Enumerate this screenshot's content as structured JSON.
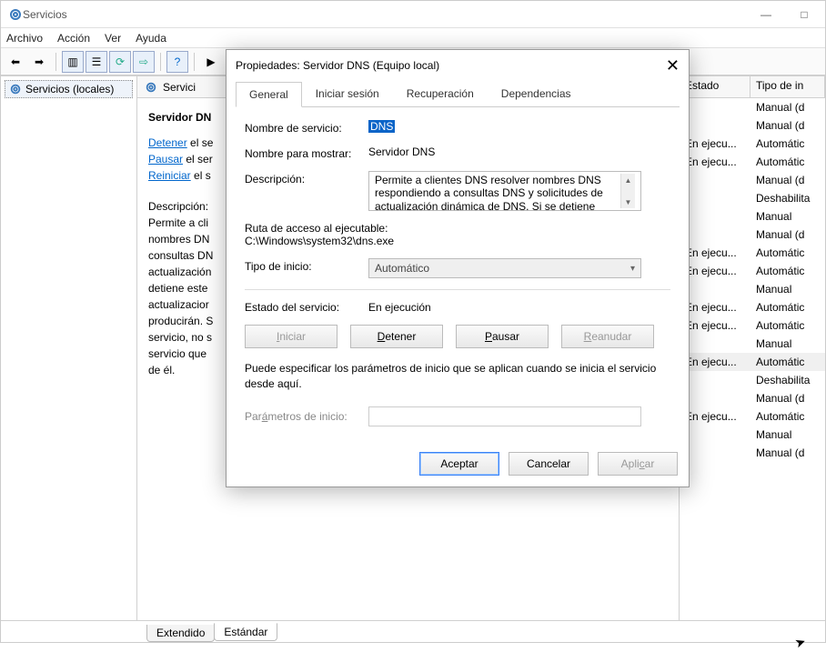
{
  "window": {
    "title": "Servicios",
    "minimize": "—",
    "maximize": "□",
    "close": "✕"
  },
  "menu": {
    "archivo": "Archivo",
    "accion": "Acción",
    "ver": "Ver",
    "ayuda": "Ayuda"
  },
  "nav": {
    "servicios_locales": "Servicios (locales)"
  },
  "center": {
    "header": "Servici",
    "svc_name": "Servidor DN",
    "link_detener_pre": "Detener",
    "link_detener_suf": " el se",
    "link_pausar_pre": "Pausar",
    "link_pausar_suf": " el ser",
    "link_reiniciar_pre": "Reiniciar",
    "link_reiniciar_suf": " el s",
    "desc_label": "Descripción:",
    "desc": "Permite a cli\nnombres DN\nconsultas DN\nactualización\ndetiene este\nactualizacior\nproducirán. S\nservicio, no s\nservicio que\nde él."
  },
  "list": {
    "col_estado": "Estado",
    "col_tipo": "Tipo de in",
    "rows": [
      {
        "estado": "",
        "tipo": "Manual (d"
      },
      {
        "estado": "",
        "tipo": "Manual (d"
      },
      {
        "estado": "En ejecu...",
        "tipo": "Automátic"
      },
      {
        "estado": "En ejecu...",
        "tipo": "Automátic"
      },
      {
        "estado": "",
        "tipo": "Manual (d"
      },
      {
        "estado": "",
        "tipo": "Deshabilita"
      },
      {
        "estado": "",
        "tipo": "Manual"
      },
      {
        "estado": "",
        "tipo": "Manual (d"
      },
      {
        "estado": "En ejecu...",
        "tipo": "Automátic"
      },
      {
        "estado": "En ejecu...",
        "tipo": "Automátic"
      },
      {
        "estado": "",
        "tipo": "Manual"
      },
      {
        "estado": "En ejecu...",
        "tipo": "Automátic"
      },
      {
        "estado": "En ejecu...",
        "tipo": "Automátic"
      },
      {
        "estado": "",
        "tipo": "Manual"
      },
      {
        "estado": "En ejecu...",
        "tipo": "Automátic",
        "sel": true
      },
      {
        "estado": "",
        "tipo": "Deshabilita"
      },
      {
        "estado": "",
        "tipo": "Manual (d"
      },
      {
        "estado": "En ejecu...",
        "tipo": "Automátic"
      },
      {
        "estado": "",
        "tipo": "Manual"
      },
      {
        "estado": "",
        "tipo": "Manual (d"
      }
    ]
  },
  "bottom_tabs": {
    "extendido": "Extendido",
    "estandar": "Estándar"
  },
  "dialog": {
    "title": "Propiedades: Servidor DNS (Equipo local)",
    "tabs": {
      "general": "General",
      "iniciar_sesion": "Iniciar sesión",
      "recuperacion": "Recuperación",
      "dependencias": "Dependencias"
    },
    "nombre_servicio_label": "Nombre de servicio:",
    "nombre_servicio_value": "DNS",
    "nombre_mostrar_label": "Nombre para mostrar:",
    "nombre_mostrar_value": "Servidor DNS",
    "descripcion_label": "Descripción:",
    "descripcion_value": "Permite a clientes DNS resolver nombres DNS respondiendo a consultas DNS y solicitudes de actualización dinámica de DNS. Si se detiene",
    "ruta_label": "Ruta de acceso al ejecutable:",
    "ruta_value": "C:\\Windows\\system32\\dns.exe",
    "tipo_inicio_label": "Tipo de inicio:",
    "tipo_inicio_value": "Automático",
    "estado_label": "Estado del servicio:",
    "estado_value": "En ejecución",
    "btn_iniciar": "Iniciar",
    "btn_detener": "Detener",
    "btn_pausar": "Pausar",
    "btn_reanudar": "Reanudar",
    "param_note": "Puede especificar los parámetros de inicio que se aplican cuando se inicia el servicio desde aquí.",
    "param_label": "Parámetros de inicio:",
    "btn_aceptar": "Aceptar",
    "btn_cancelar": "Cancelar",
    "btn_aplicar": "Aplicar"
  }
}
